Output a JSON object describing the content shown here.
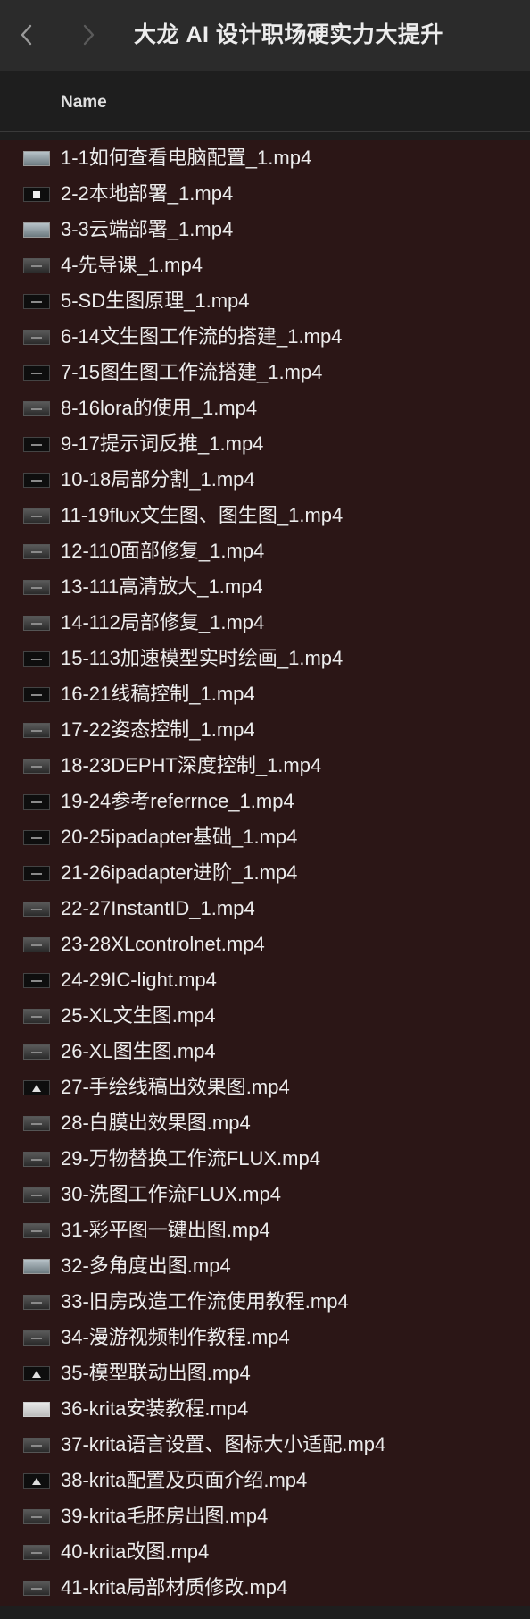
{
  "window": {
    "title": "大龙 AI 设计职场硬实力大提升"
  },
  "icons": {
    "back": "chevron-left-icon",
    "forward": "chevron-right-icon"
  },
  "colors": {
    "toolbar": "#2b2b2b",
    "row_background": "#2b1616",
    "text": "#ececec"
  },
  "columns": {
    "name": "Name"
  },
  "files": [
    {
      "name": "1-1如何查看电脑配置_1.mp4",
      "thumb": "light"
    },
    {
      "name": "2-2本地部署_1.mp4",
      "thumb": "white-mark"
    },
    {
      "name": "3-3云端部署_1.mp4",
      "thumb": "light"
    },
    {
      "name": "4-先导课_1.mp4",
      "thumb": "mid"
    },
    {
      "name": "5-SD生图原理_1.mp4",
      "thumb": "dark"
    },
    {
      "name": "6-14文生图工作流的搭建_1.mp4",
      "thumb": "mid"
    },
    {
      "name": "7-15图生图工作流搭建_1.mp4",
      "thumb": "dark"
    },
    {
      "name": "8-16lora的使用_1.mp4",
      "thumb": "mid"
    },
    {
      "name": "9-17提示词反推_1.mp4",
      "thumb": "dark"
    },
    {
      "name": "10-18局部分割_1.mp4",
      "thumb": "dark"
    },
    {
      "name": "11-19flux文生图、图生图_1.mp4",
      "thumb": "mid"
    },
    {
      "name": "12-110面部修复_1.mp4",
      "thumb": "mid"
    },
    {
      "name": "13-111高清放大_1.mp4",
      "thumb": "mid"
    },
    {
      "name": "14-112局部修复_1.mp4",
      "thumb": "mid"
    },
    {
      "name": "15-113加速模型实时绘画_1.mp4",
      "thumb": "dark"
    },
    {
      "name": "16-21线稿控制_1.mp4",
      "thumb": "dark"
    },
    {
      "name": "17-22姿态控制_1.mp4",
      "thumb": "mid"
    },
    {
      "name": "18-23DEPHT深度控制_1.mp4",
      "thumb": "mid"
    },
    {
      "name": "19-24参考referrnce_1.mp4",
      "thumb": "dark"
    },
    {
      "name": "20-25ipadapter基础_1.mp4",
      "thumb": "dark"
    },
    {
      "name": "21-26ipadapter进阶_1.mp4",
      "thumb": "dark"
    },
    {
      "name": "22-27InstantID_1.mp4",
      "thumb": "mid"
    },
    {
      "name": "23-28XLcontrolnet.mp4",
      "thumb": "mid"
    },
    {
      "name": "24-29IC-light.mp4",
      "thumb": "dark"
    },
    {
      "name": "25-XL文生图.mp4",
      "thumb": "mid"
    },
    {
      "name": "26-XL图生图.mp4",
      "thumb": "mid"
    },
    {
      "name": "27-手绘线稿出效果图.mp4",
      "thumb": "triangle"
    },
    {
      "name": "28-白膜出效果图.mp4",
      "thumb": "mid"
    },
    {
      "name": "29-万物替换工作流FLUX.mp4",
      "thumb": "mid"
    },
    {
      "name": "30-洗图工作流FLUX.mp4",
      "thumb": "mid"
    },
    {
      "name": "31-彩平图一键出图.mp4",
      "thumb": "mid"
    },
    {
      "name": "32-多角度出图.mp4",
      "thumb": "light"
    },
    {
      "name": "33-旧房改造工作流使用教程.mp4",
      "thumb": "mid"
    },
    {
      "name": "34-漫游视频制作教程.mp4",
      "thumb": "mid"
    },
    {
      "name": "35-模型联动出图.mp4",
      "thumb": "triangle"
    },
    {
      "name": "36-krita安装教程.mp4",
      "thumb": "white"
    },
    {
      "name": "37-krita语言设置、图标大小适配.mp4",
      "thumb": "mid"
    },
    {
      "name": "38-krita配置及页面介绍.mp4",
      "thumb": "triangle"
    },
    {
      "name": "39-krita毛胚房出图.mp4",
      "thumb": "mid"
    },
    {
      "name": "40-krita改图.mp4",
      "thumb": "mid"
    },
    {
      "name": "41-krita局部材质修改.mp4",
      "thumb": "mid"
    }
  ]
}
